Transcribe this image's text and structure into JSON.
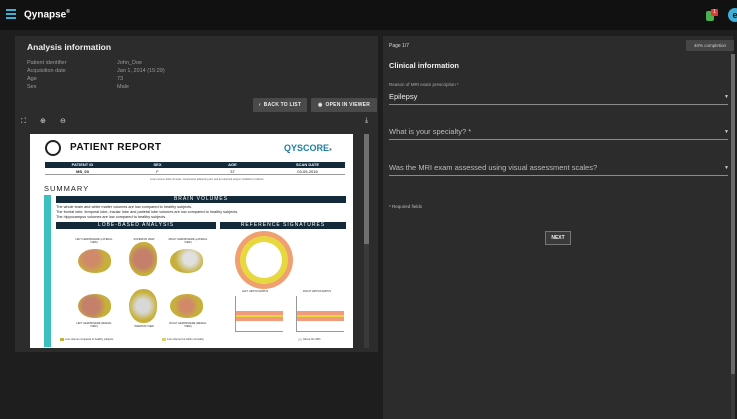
{
  "app": {
    "brand": "Qynapse",
    "notification_count": "1",
    "user_initial": "e"
  },
  "info": {
    "title": "Analysis information",
    "rows": [
      {
        "label": "Patient identifier",
        "value": "John_Doe"
      },
      {
        "label": "Acquisition date",
        "value": "Jan 1, 2014 (15:29)"
      },
      {
        "label": "Age",
        "value": "73"
      },
      {
        "label": "Sex",
        "value": "Male"
      }
    ]
  },
  "actions": {
    "back": "BACK TO LIST",
    "open_viewer": "OPEN IN VIEWER"
  },
  "report": {
    "title": "PATIENT REPORT",
    "brand": "QYSCORE",
    "brand_mark": "®",
    "table_headers": [
      "PATIENT ID",
      "SEX",
      "AGE",
      "SCAN DATE"
    ],
    "table_values": [
      "MS_03",
      "F",
      "37",
      "03-05-2016"
    ],
    "note": "Lorem ipsum dolor sit amet, consectetur adipiscing elit, sed do eiusmod tempor incididunt ut labore.",
    "summary": "SUMMARY",
    "side_label": "BRAIN VOLUMETRY",
    "brain_volumes": "BRAIN VOLUMES",
    "summary_lines": [
      "The whole brain and white matter volumes are low compared to healthy subjects.",
      "The frontal lobe, temporal lobe, insular lobe and parietal lobe volumes are low compared to healthy subjects.",
      "The hippocampus volumes are low compared to healthy subjects."
    ],
    "lobe_analysis": "LOBE-BASED ANALYSIS",
    "ref_signatures": "REFERENCE SIGNATURES",
    "brain_captions": [
      "LEFT HEMISPHERE (LATERAL VIEW)",
      "SUPERIOR VIEW",
      "RIGHT HEMISPHERE (LATERAL VIEW)",
      "LEFT HEMISPHERE (MEDIAL VIEW)",
      "INFERIOR VIEW",
      "RIGHT HEMISPHERE (MEDIAL VIEW)"
    ],
    "chart_labels": [
      "LEFT HIPPOCAMPUS",
      "RIGHT HIPPOCAMPUS"
    ],
    "legend": [
      "Low volume compared to healthy subjects",
      "Low volume but within normality",
      "Above the 95th"
    ]
  },
  "form": {
    "page": "Page 1/7",
    "completion": "40% completion",
    "section": "Clinical information",
    "fields": [
      {
        "label": "Reason of MRI exam prescription *",
        "value": "Epilepsy"
      },
      {
        "label": "",
        "value": "What is your specialty? *"
      },
      {
        "label": "",
        "value": "Was the MRI exam assessed using visual assessment scales?"
      }
    ],
    "required_note": "* Required fields",
    "next": "NEXT"
  },
  "colors": {
    "accent": "#3fb0d8",
    "teal": "#3cbfbf",
    "navy": "#132a3a",
    "notification": "#e53935"
  }
}
